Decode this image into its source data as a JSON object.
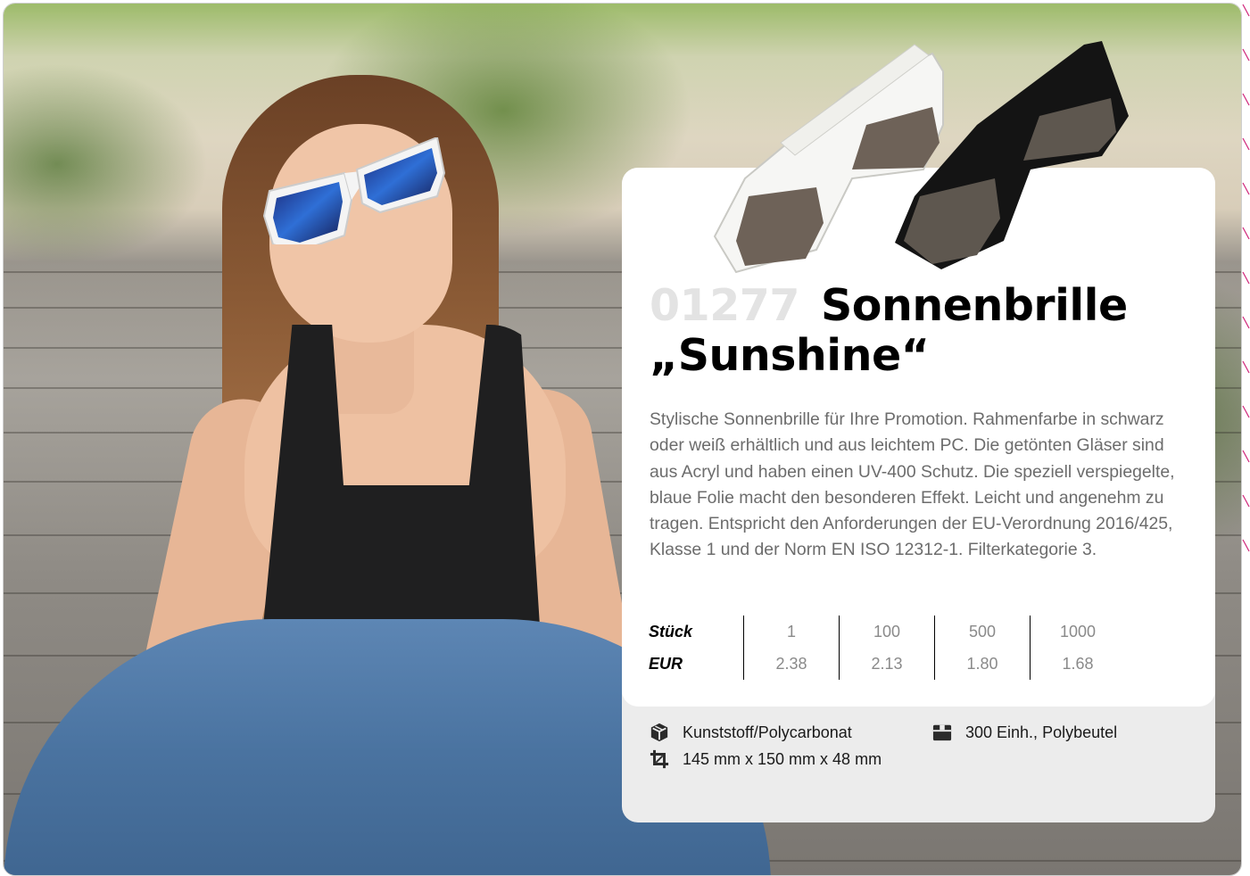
{
  "product": {
    "number": "01277",
    "title_line1": "Sonnenbrille",
    "title_line2": "„Sunshine“",
    "description": "Stylische Sonnenbrille für Ihre Promotion. Rahmenfarbe in schwarz oder weiß erhältlich und aus leichtem PC. Die getönten Gläser sind aus Acryl und haben einen UV-400 Schutz. Die speziell verspiegelte, blaue Folie macht den besonderen Effekt. Leicht und angenehm zu tragen. Entspricht den Anforderungen der EU-Verordnung 2016/425, Klasse 1 und der Norm EN ISO 12312-1. Filterkategorie 3."
  },
  "pricing": {
    "quantity_label": "Stück",
    "currency_label": "EUR",
    "quantities": [
      "1",
      "100",
      "500",
      "1000"
    ],
    "prices": [
      "2.38",
      "2.13",
      "1.80",
      "1.68"
    ]
  },
  "specs": {
    "material": {
      "icon": "box-icon",
      "text": "Kunststoff/Polycarbonat"
    },
    "dimensions": {
      "icon": "crop-icon",
      "text": "145 mm x 150 mm x 48 mm"
    },
    "packaging": {
      "icon": "package-icon",
      "text": "300 Einh., Polybeutel"
    }
  },
  "colors": {
    "accent": "#d0267a",
    "card_bg": "#ffffff",
    "spec_bg": "#ececec"
  }
}
